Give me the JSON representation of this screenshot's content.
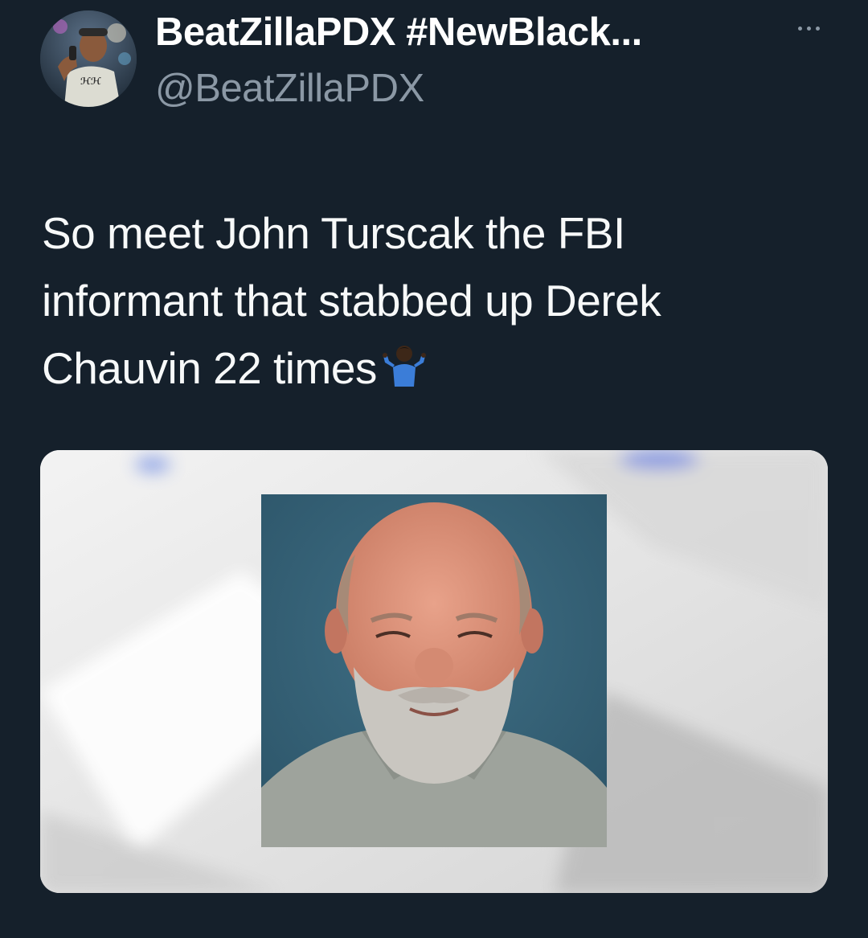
{
  "tweet": {
    "display_name": "BeatZillaPDX #NewBlack...",
    "handle": "@BeatZillaPDX",
    "text_lines": [
      "So meet John Turscak the FBI",
      "informant that stabbed up Derek",
      "Chauvin 22 times"
    ],
    "emoji": "🤷🏿‍♂️"
  },
  "icons": {
    "more": "more-horizontal-icon",
    "avatar": "user-avatar",
    "emoji": "person-shrugging-emoji"
  },
  "colors": {
    "background": "#15202b",
    "primary_text": "#f7f9f9",
    "secondary_text": "#8b98a5"
  }
}
